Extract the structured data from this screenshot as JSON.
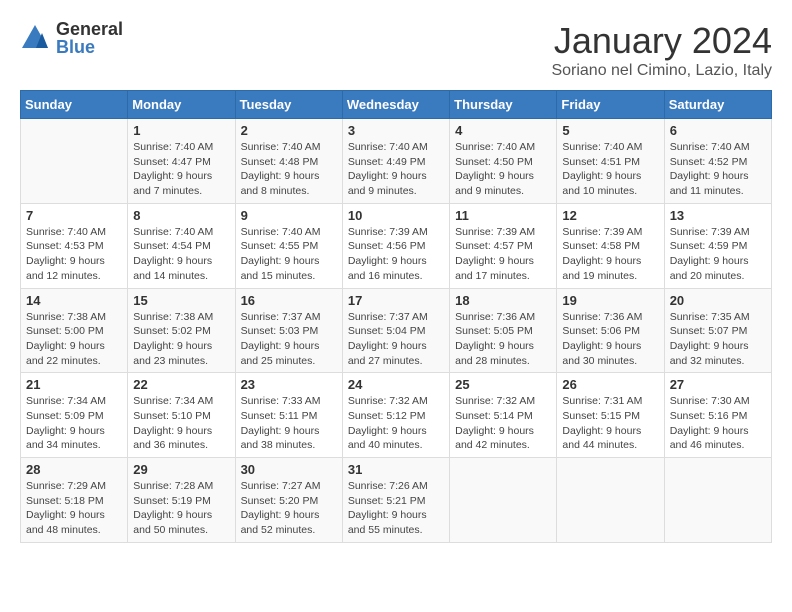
{
  "header": {
    "logo_line1": "General",
    "logo_line2": "Blue",
    "month": "January 2024",
    "location": "Soriano nel Cimino, Lazio, Italy"
  },
  "days_of_week": [
    "Sunday",
    "Monday",
    "Tuesday",
    "Wednesday",
    "Thursday",
    "Friday",
    "Saturday"
  ],
  "weeks": [
    [
      {
        "day": "",
        "info": ""
      },
      {
        "day": "1",
        "info": "Sunrise: 7:40 AM\nSunset: 4:47 PM\nDaylight: 9 hours\nand 7 minutes."
      },
      {
        "day": "2",
        "info": "Sunrise: 7:40 AM\nSunset: 4:48 PM\nDaylight: 9 hours\nand 8 minutes."
      },
      {
        "day": "3",
        "info": "Sunrise: 7:40 AM\nSunset: 4:49 PM\nDaylight: 9 hours\nand 9 minutes."
      },
      {
        "day": "4",
        "info": "Sunrise: 7:40 AM\nSunset: 4:50 PM\nDaylight: 9 hours\nand 9 minutes."
      },
      {
        "day": "5",
        "info": "Sunrise: 7:40 AM\nSunset: 4:51 PM\nDaylight: 9 hours\nand 10 minutes."
      },
      {
        "day": "6",
        "info": "Sunrise: 7:40 AM\nSunset: 4:52 PM\nDaylight: 9 hours\nand 11 minutes."
      }
    ],
    [
      {
        "day": "7",
        "info": "Sunrise: 7:40 AM\nSunset: 4:53 PM\nDaylight: 9 hours\nand 12 minutes."
      },
      {
        "day": "8",
        "info": "Sunrise: 7:40 AM\nSunset: 4:54 PM\nDaylight: 9 hours\nand 14 minutes."
      },
      {
        "day": "9",
        "info": "Sunrise: 7:40 AM\nSunset: 4:55 PM\nDaylight: 9 hours\nand 15 minutes."
      },
      {
        "day": "10",
        "info": "Sunrise: 7:39 AM\nSunset: 4:56 PM\nDaylight: 9 hours\nand 16 minutes."
      },
      {
        "day": "11",
        "info": "Sunrise: 7:39 AM\nSunset: 4:57 PM\nDaylight: 9 hours\nand 17 minutes."
      },
      {
        "day": "12",
        "info": "Sunrise: 7:39 AM\nSunset: 4:58 PM\nDaylight: 9 hours\nand 19 minutes."
      },
      {
        "day": "13",
        "info": "Sunrise: 7:39 AM\nSunset: 4:59 PM\nDaylight: 9 hours\nand 20 minutes."
      }
    ],
    [
      {
        "day": "14",
        "info": "Sunrise: 7:38 AM\nSunset: 5:00 PM\nDaylight: 9 hours\nand 22 minutes."
      },
      {
        "day": "15",
        "info": "Sunrise: 7:38 AM\nSunset: 5:02 PM\nDaylight: 9 hours\nand 23 minutes."
      },
      {
        "day": "16",
        "info": "Sunrise: 7:37 AM\nSunset: 5:03 PM\nDaylight: 9 hours\nand 25 minutes."
      },
      {
        "day": "17",
        "info": "Sunrise: 7:37 AM\nSunset: 5:04 PM\nDaylight: 9 hours\nand 27 minutes."
      },
      {
        "day": "18",
        "info": "Sunrise: 7:36 AM\nSunset: 5:05 PM\nDaylight: 9 hours\nand 28 minutes."
      },
      {
        "day": "19",
        "info": "Sunrise: 7:36 AM\nSunset: 5:06 PM\nDaylight: 9 hours\nand 30 minutes."
      },
      {
        "day": "20",
        "info": "Sunrise: 7:35 AM\nSunset: 5:07 PM\nDaylight: 9 hours\nand 32 minutes."
      }
    ],
    [
      {
        "day": "21",
        "info": "Sunrise: 7:34 AM\nSunset: 5:09 PM\nDaylight: 9 hours\nand 34 minutes."
      },
      {
        "day": "22",
        "info": "Sunrise: 7:34 AM\nSunset: 5:10 PM\nDaylight: 9 hours\nand 36 minutes."
      },
      {
        "day": "23",
        "info": "Sunrise: 7:33 AM\nSunset: 5:11 PM\nDaylight: 9 hours\nand 38 minutes."
      },
      {
        "day": "24",
        "info": "Sunrise: 7:32 AM\nSunset: 5:12 PM\nDaylight: 9 hours\nand 40 minutes."
      },
      {
        "day": "25",
        "info": "Sunrise: 7:32 AM\nSunset: 5:14 PM\nDaylight: 9 hours\nand 42 minutes."
      },
      {
        "day": "26",
        "info": "Sunrise: 7:31 AM\nSunset: 5:15 PM\nDaylight: 9 hours\nand 44 minutes."
      },
      {
        "day": "27",
        "info": "Sunrise: 7:30 AM\nSunset: 5:16 PM\nDaylight: 9 hours\nand 46 minutes."
      }
    ],
    [
      {
        "day": "28",
        "info": "Sunrise: 7:29 AM\nSunset: 5:18 PM\nDaylight: 9 hours\nand 48 minutes."
      },
      {
        "day": "29",
        "info": "Sunrise: 7:28 AM\nSunset: 5:19 PM\nDaylight: 9 hours\nand 50 minutes."
      },
      {
        "day": "30",
        "info": "Sunrise: 7:27 AM\nSunset: 5:20 PM\nDaylight: 9 hours\nand 52 minutes."
      },
      {
        "day": "31",
        "info": "Sunrise: 7:26 AM\nSunset: 5:21 PM\nDaylight: 9 hours\nand 55 minutes."
      },
      {
        "day": "",
        "info": ""
      },
      {
        "day": "",
        "info": ""
      },
      {
        "day": "",
        "info": ""
      }
    ]
  ]
}
